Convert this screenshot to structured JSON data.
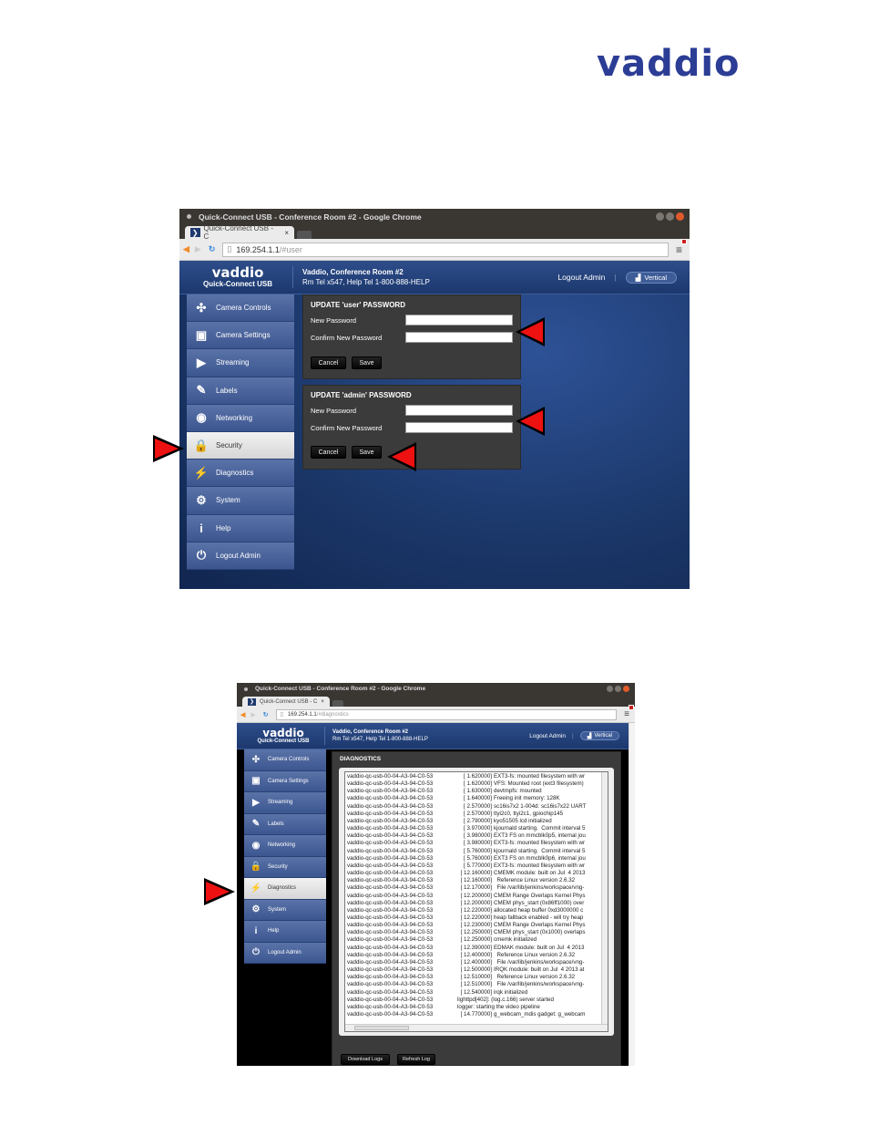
{
  "doc_logo": "vaddio",
  "screenshot1": {
    "window_title": "Quick-Connect USB - Conference Room #2 - Google Chrome",
    "tab_label": "Quick-Connect USB - C",
    "tab_close": "×",
    "url_host": "169.254.1.1",
    "url_path": "/#user",
    "brand_logo": "vaddio",
    "brand_product": "Quick-Connect USB",
    "room_name": "Vaddio, Conference Room #2",
    "room_tel": "Rm Tel x547, Help Tel 1-800-888-HELP",
    "logout_link": "Logout Admin",
    "layout_button": "Vertical",
    "active_nav": "Security",
    "user_panel": {
      "title": "UPDATE 'user' PASSWORD",
      "new_label": "New Password",
      "confirm_label": "Confirm New Password",
      "new_value": "",
      "confirm_value": "",
      "cancel": "Cancel",
      "save": "Save"
    },
    "admin_panel": {
      "title": "UPDATE 'admin' PASSWORD",
      "new_label": "New Password",
      "confirm_label": "Confirm New Password",
      "new_value": "",
      "confirm_value": "",
      "cancel": "Cancel",
      "save": "Save"
    }
  },
  "nav_items": [
    {
      "label": "Camera Controls",
      "icon": "camera-controls-icon",
      "glyph": "✣"
    },
    {
      "label": "Camera Settings",
      "icon": "camera-settings-icon",
      "glyph": "▣"
    },
    {
      "label": "Streaming",
      "icon": "streaming-icon",
      "glyph": "▶"
    },
    {
      "label": "Labels",
      "icon": "labels-icon",
      "glyph": "✎"
    },
    {
      "label": "Networking",
      "icon": "networking-icon",
      "glyph": "◉"
    },
    {
      "label": "Security",
      "icon": "lock-icon",
      "glyph": "🔒"
    },
    {
      "label": "Diagnostics",
      "icon": "diagnostics-icon",
      "glyph": "⚡"
    },
    {
      "label": "System",
      "icon": "system-gear-icon",
      "glyph": "⚙"
    },
    {
      "label": "Help",
      "icon": "info-icon",
      "glyph": "i"
    },
    {
      "label": "Logout Admin",
      "icon": "power-icon",
      "glyph": "⏻"
    }
  ],
  "screenshot2": {
    "window_title": "Quick-Connect USB - Conference Room #2 - Google Chrome",
    "tab_label": "Quick-Connect USB - C",
    "tab_close": "×",
    "url_host": "169.254.1.1",
    "url_path": "/#diagnostics",
    "brand_logo": "vaddio",
    "brand_product": "Quick-Connect USB",
    "room_name": "Vaddio, Conference Room #2",
    "room_tel": "Rm Tel x547, Help Tel 1-800-888-HELP",
    "logout_link": "Logout Admin",
    "layout_button": "Vertical",
    "active_nav": "Diagnostics",
    "panel_title": "DIAGNOSTICS",
    "download_logs": "Download Logs",
    "refresh_log": "Refresh Log",
    "log_host": "vaddio-qc-usb-00-04-A3-94-C0-53",
    "log_lines": [
      {
        "ts": "[     1.620000]",
        "msg": "EXT3-fs: mounted filesystem with wr"
      },
      {
        "ts": "[     1.620000]",
        "msg": "VFS: Mounted root (ext3 filesystem)"
      },
      {
        "ts": "[     1.630000]",
        "msg": "devtmpfs: mounted"
      },
      {
        "ts": "[     1.640000]",
        "msg": "Freeing init memory: 128K"
      },
      {
        "ts": "[     2.570000]",
        "msg": "sc16is7x2 1-004d: sc16is7x22 UART"
      },
      {
        "ts": "[     2.570000]",
        "msg": "ttyi2c0, ttyi2c1, gpiochip145"
      },
      {
        "ts": "[     2.790000]",
        "msg": "kyo51505 lcd initialized"
      },
      {
        "ts": "[     3.970000]",
        "msg": "kjournald starting.  Commit interval 5"
      },
      {
        "ts": "[     3.980000]",
        "msg": "EXT3 FS on mmcblk0p5, internal jou"
      },
      {
        "ts": "[     3.980000]",
        "msg": "EXT3-fs: mounted filesystem with wr"
      },
      {
        "ts": "[     5.760000]",
        "msg": "kjournald starting.  Commit interval 5"
      },
      {
        "ts": "[     5.760000]",
        "msg": "EXT3 FS on mmcblk0p6, internal jou"
      },
      {
        "ts": "[     5.770000]",
        "msg": "EXT3-fs: mounted filesystem with wr"
      },
      {
        "ts": "[   12.160000]",
        "msg": "CMEMK module: built on Jul  4 2013"
      },
      {
        "ts": "[   12.160000]",
        "msg": "  Reference Linux version 2.6.32"
      },
      {
        "ts": "[   12.170000]",
        "msg": "  File /var/lib/jenkins/workspace/vng-"
      },
      {
        "ts": "[   12.200000]",
        "msg": "CMEM Range Overlaps Kernel Phys"
      },
      {
        "ts": "[   12.200000]",
        "msg": "CMEM phys_start (0x86ff1000) over"
      },
      {
        "ts": "[   12.220000]",
        "msg": "allocated heap buffer 0xd3000000 c"
      },
      {
        "ts": "[   12.220000]",
        "msg": "heap fallback enabled - will try heap"
      },
      {
        "ts": "[   12.230000]",
        "msg": "CMEM Range Overlaps Kernel Phys"
      },
      {
        "ts": "[   12.250000]",
        "msg": "CMEM phys_start (0x1000) overlaps"
      },
      {
        "ts": "[   12.250000]",
        "msg": "cmemk initialized"
      },
      {
        "ts": "[   12.390000]",
        "msg": "EDMAK module: built on Jul  4 2013"
      },
      {
        "ts": "[   12.400000]",
        "msg": "  Reference Linux version 2.6.32"
      },
      {
        "ts": "[   12.400000]",
        "msg": "  File /var/lib/jenkins/workspace/vng-"
      },
      {
        "ts": "[   12.500000]",
        "msg": "IRQK module: built on Jul  4 2013 at"
      },
      {
        "ts": "[   12.510000]",
        "msg": "  Reference Linux version 2.6.32"
      },
      {
        "ts": "[   12.510000]",
        "msg": "  File /var/lib/jenkins/workspace/vng-"
      },
      {
        "ts": "[   12.540000]",
        "msg": "irqk initialized"
      },
      {
        "ts": "",
        "msg": "lighttpd[402]: (log.c.166) server started"
      },
      {
        "ts": "",
        "msg": "logger: starting the video pipeline"
      },
      {
        "ts": "[   14.770000]",
        "msg": "g_webcam_mdis gadget: g_webcam"
      }
    ]
  },
  "colors": {
    "brand_blue": "#2c3d95",
    "pointer_red": "#e11111",
    "app_header": "#1f3a6e"
  }
}
